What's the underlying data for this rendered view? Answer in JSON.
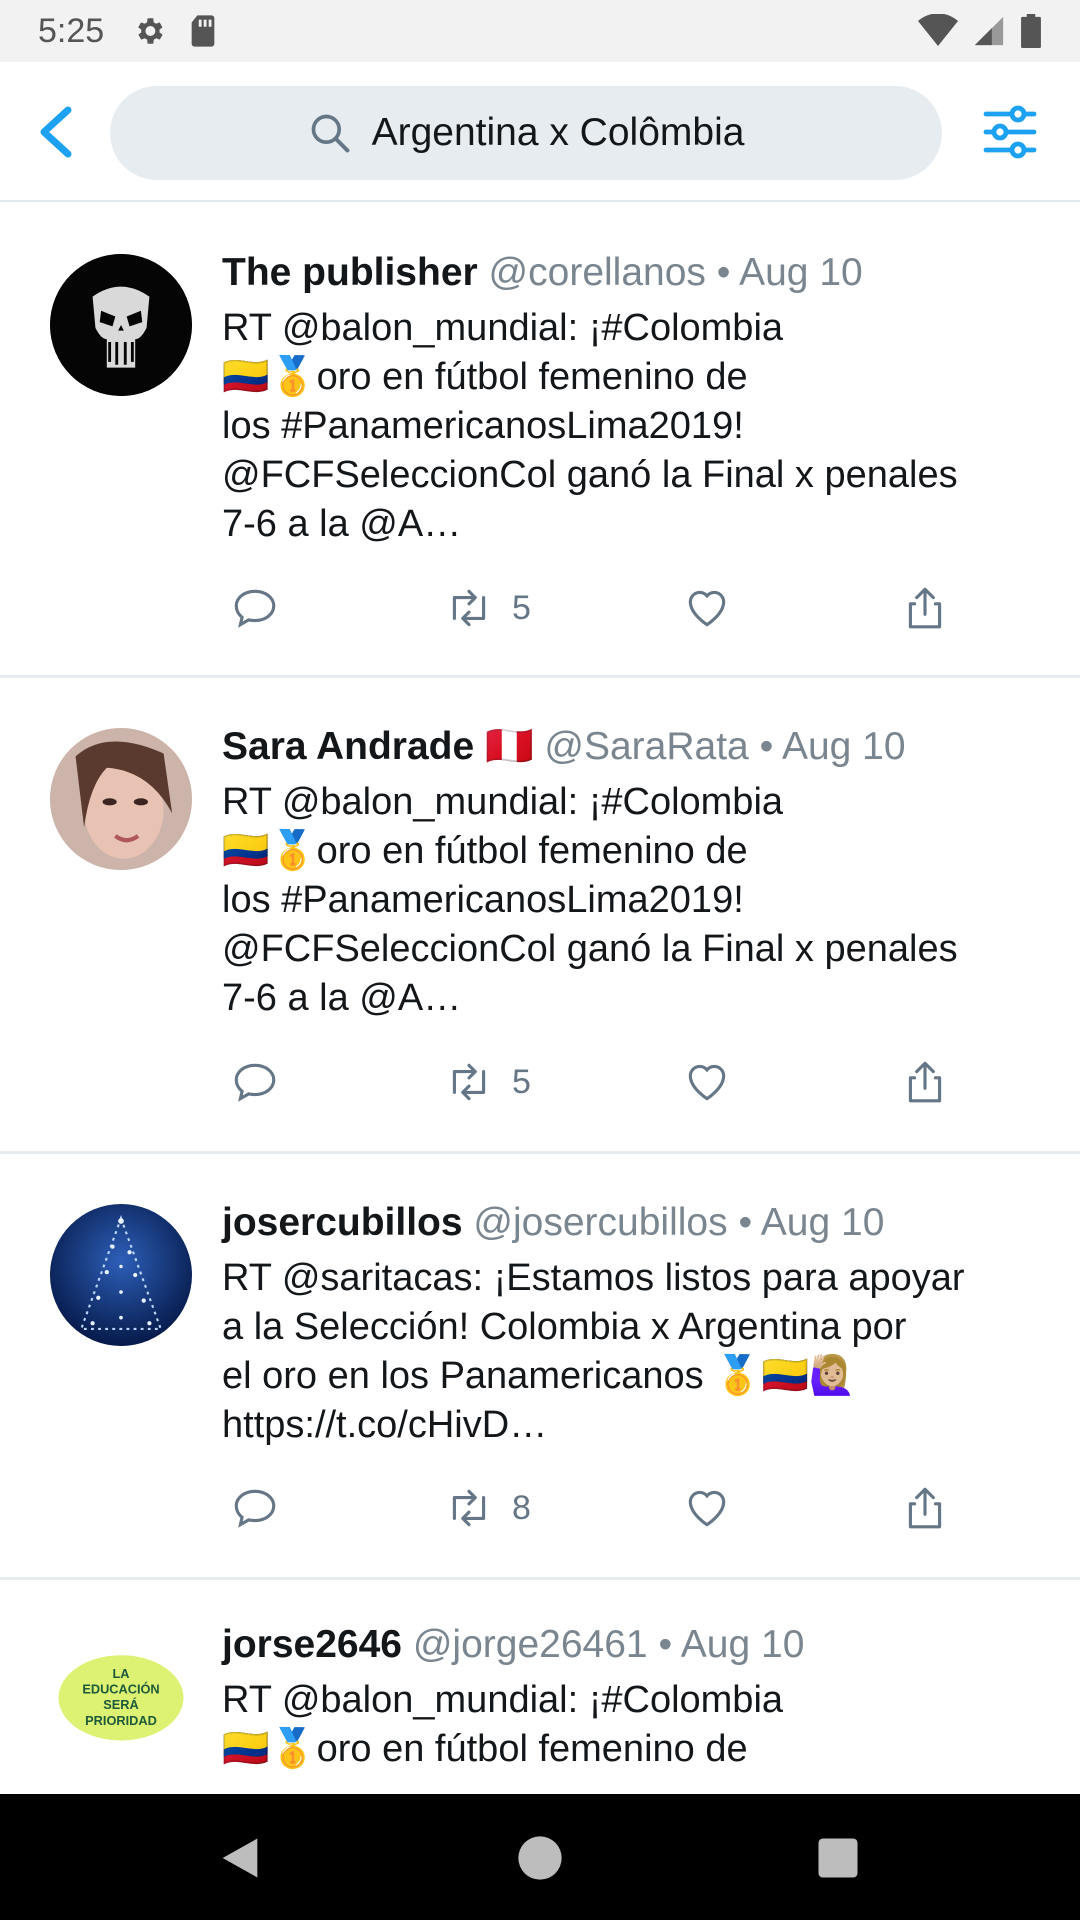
{
  "status_bar": {
    "time": "5:25"
  },
  "search": {
    "query": "Argentina x Colômbia"
  },
  "tweets": [
    {
      "name": "The publisher",
      "handle": "@corellanos",
      "separator": "•",
      "date": "Aug 10",
      "text": "RT @balon_mundial: ¡#Colombia\n🇨🇴🥇oro en fútbol femenino de\nlos #PanamericanosLima2019!\n@FCFSeleccionCol ganó la Final x penales\n7-6 a la @A…",
      "retweets": "5",
      "avatar_icon": "skull-avatar-icon"
    },
    {
      "name": "Sara Andrade 🇵🇪",
      "handle": "@SaraRata",
      "separator": "•",
      "date": "Aug 10",
      "text": "RT @balon_mundial: ¡#Colombia\n🇨🇴🥇oro en fútbol femenino de\nlos #PanamericanosLima2019!\n@FCFSeleccionCol ganó la Final x penales\n7-6 a la @A…",
      "retweets": "5",
      "avatar_icon": "portrait-avatar-icon"
    },
    {
      "name": "josercubillos",
      "handle": "@josercubillos",
      "separator": "•",
      "date": "Aug 10",
      "text": "RT @saritacas: ¡Estamos listos para apoyar\na la Selección! Colombia x Argentina por\nel oro en los Panamericanos 🥇🇨🇴🙋🏼‍♀️\nhttps://t.co/cHivD…",
      "retweets": "8",
      "avatar_icon": "christmas-tree-avatar-icon"
    },
    {
      "name": "jorse2646",
      "handle": "@jorge26461",
      "separator": "•",
      "date": "Aug 10",
      "text": "RT @balon_mundial: ¡#Colombia\n🇨🇴🥇oro en fútbol femenino de",
      "retweets": "",
      "avatar_icon": "education-logo-avatar-icon",
      "avatar_text": "LA EDUCACIÓN SERÁ PRIORIDAD"
    }
  ],
  "colors": {
    "accent": "#1da1f2",
    "muted": "#7a868f",
    "search_bg": "#e6ecf0",
    "divider": "#e6ecf0"
  }
}
